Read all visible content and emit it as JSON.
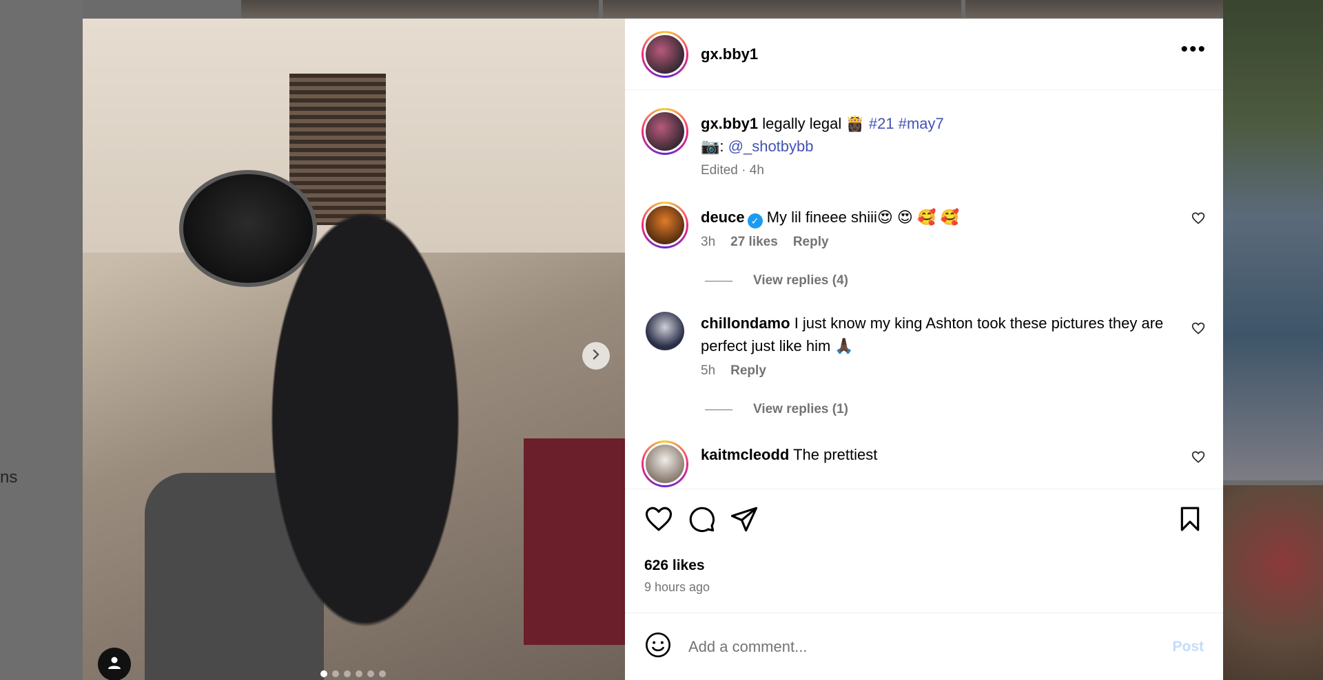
{
  "background": {
    "left_text": "ns"
  },
  "post": {
    "username": "gx.bby1",
    "caption": {
      "username": "gx.bby1",
      "text": "legally legal",
      "emoji": "👸🏿",
      "hashtags": [
        "#21",
        "#may7"
      ],
      "credit_prefix": "📷:",
      "credit_handle": "@_shotbybb",
      "meta": "Edited · 4h"
    },
    "comments": [
      {
        "username": "deuce",
        "verified": true,
        "text": "My lil fineee shiii😍 😍 🥰 🥰",
        "time": "3h",
        "likes": "27 likes",
        "reply": "Reply",
        "view_replies": "View replies (4)"
      },
      {
        "username": "chillondamo",
        "verified": false,
        "text": "I just know my king Ashton took these pictures they are perfect just like him 🙏🏿",
        "time": "5h",
        "reply": "Reply",
        "view_replies": "View replies (1)"
      },
      {
        "username": "kaitmcleodd",
        "verified": false,
        "text": "The prettiest"
      }
    ],
    "likes": "626 likes",
    "time_ago": "9 hours ago",
    "add_comment_placeholder": "Add a comment...",
    "post_label": "Post"
  },
  "carousel": {
    "count": 6,
    "active": 0
  },
  "icons": {
    "more": "more-options-icon",
    "like": "heart-icon",
    "comment": "comment-icon",
    "share": "share-icon",
    "save": "bookmark-icon",
    "emoji": "emoji-icon",
    "next": "chevron-right-icon",
    "tag": "user-tag-icon"
  },
  "colors": {
    "link": "#4252b5",
    "secondary_text": "#737373",
    "verified": "#1d9bf0",
    "post_disabled": "#c2dcf7"
  }
}
